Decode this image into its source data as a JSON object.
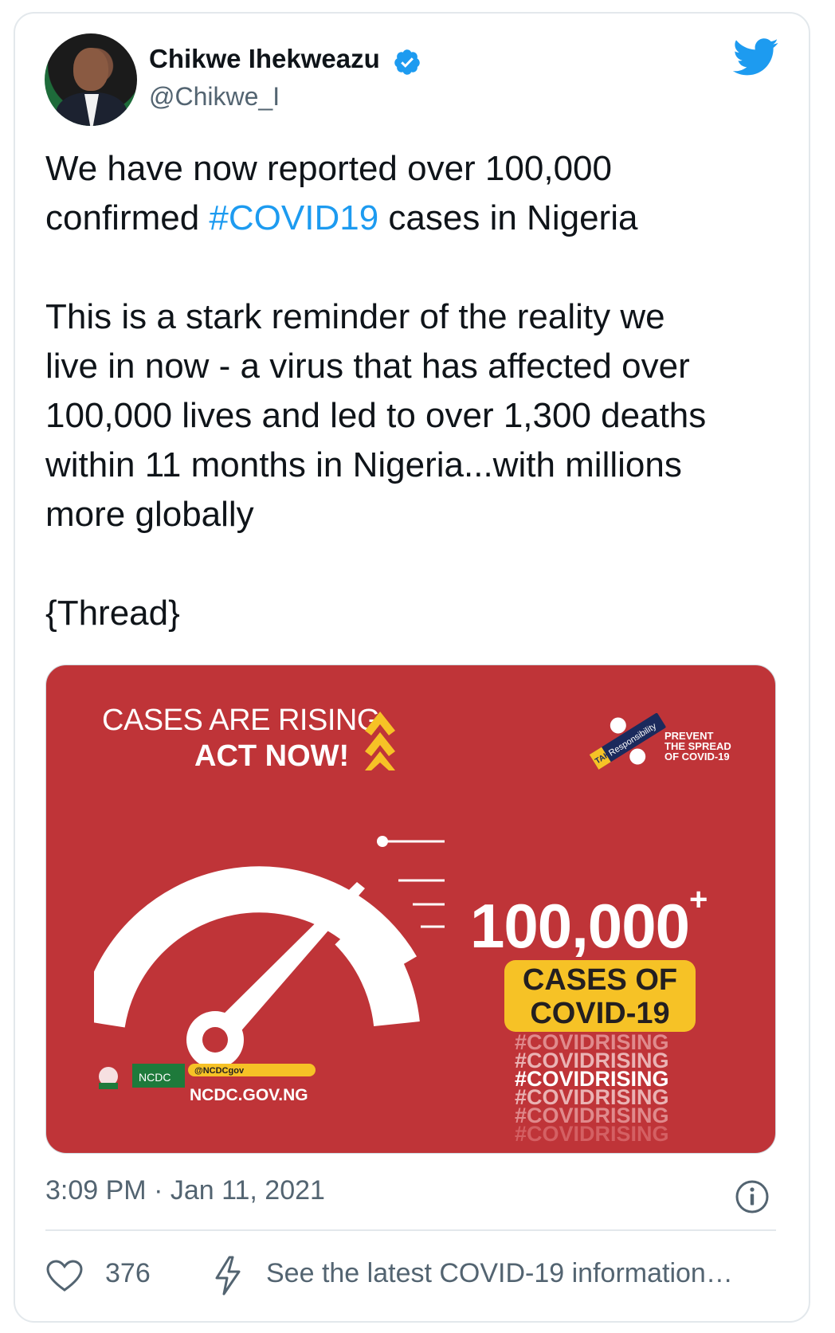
{
  "author": {
    "name": "Chikwe Ihekweazu",
    "handle": "@Chikwe_I"
  },
  "tweet": {
    "line1": "We have now reported over 100,000",
    "line2_pre": "confirmed ",
    "line2_hashtag": "#COVID19",
    "line2_post": " cases in Nigeria",
    "para2": "This is a stark reminder of the reality we\nlive in now - a virus that has affected over\n100,000 lives and led to over 1,300 deaths\nwithin 11 months in Nigeria...with millions\nmore globally",
    "thread": "{Thread}"
  },
  "media": {
    "headline1": "CASES ARE RISING",
    "headline2": "ACT NOW!",
    "badge_take": "TAKE",
    "badge_responsibility": "Responsibility",
    "prevent": "PREVENT\nTHE SPREAD\nOF COVID-19",
    "big_number": "100,000",
    "big_plus": "+",
    "box_line1": "CASES OF",
    "box_line2": "COVID-19",
    "tags": [
      "#COVIDRISING",
      "#COVIDRISING",
      "#COVIDRISING",
      "#COVIDRISING",
      "#COVIDRISING",
      "#COVIDRISING"
    ],
    "ncdc": "NCDC",
    "social_handle": "@NCDCgov",
    "site": "NCDC.GOV.NG"
  },
  "meta": {
    "timestamp": "3:09 PM · Jan 11, 2021",
    "likes": "376",
    "covid_info": "See the latest COVID-19 information…"
  },
  "colors": {
    "accent": "#1d9bf0",
    "media_red": "#bf3438",
    "yellow": "#f6c226",
    "muted": "#536471"
  }
}
